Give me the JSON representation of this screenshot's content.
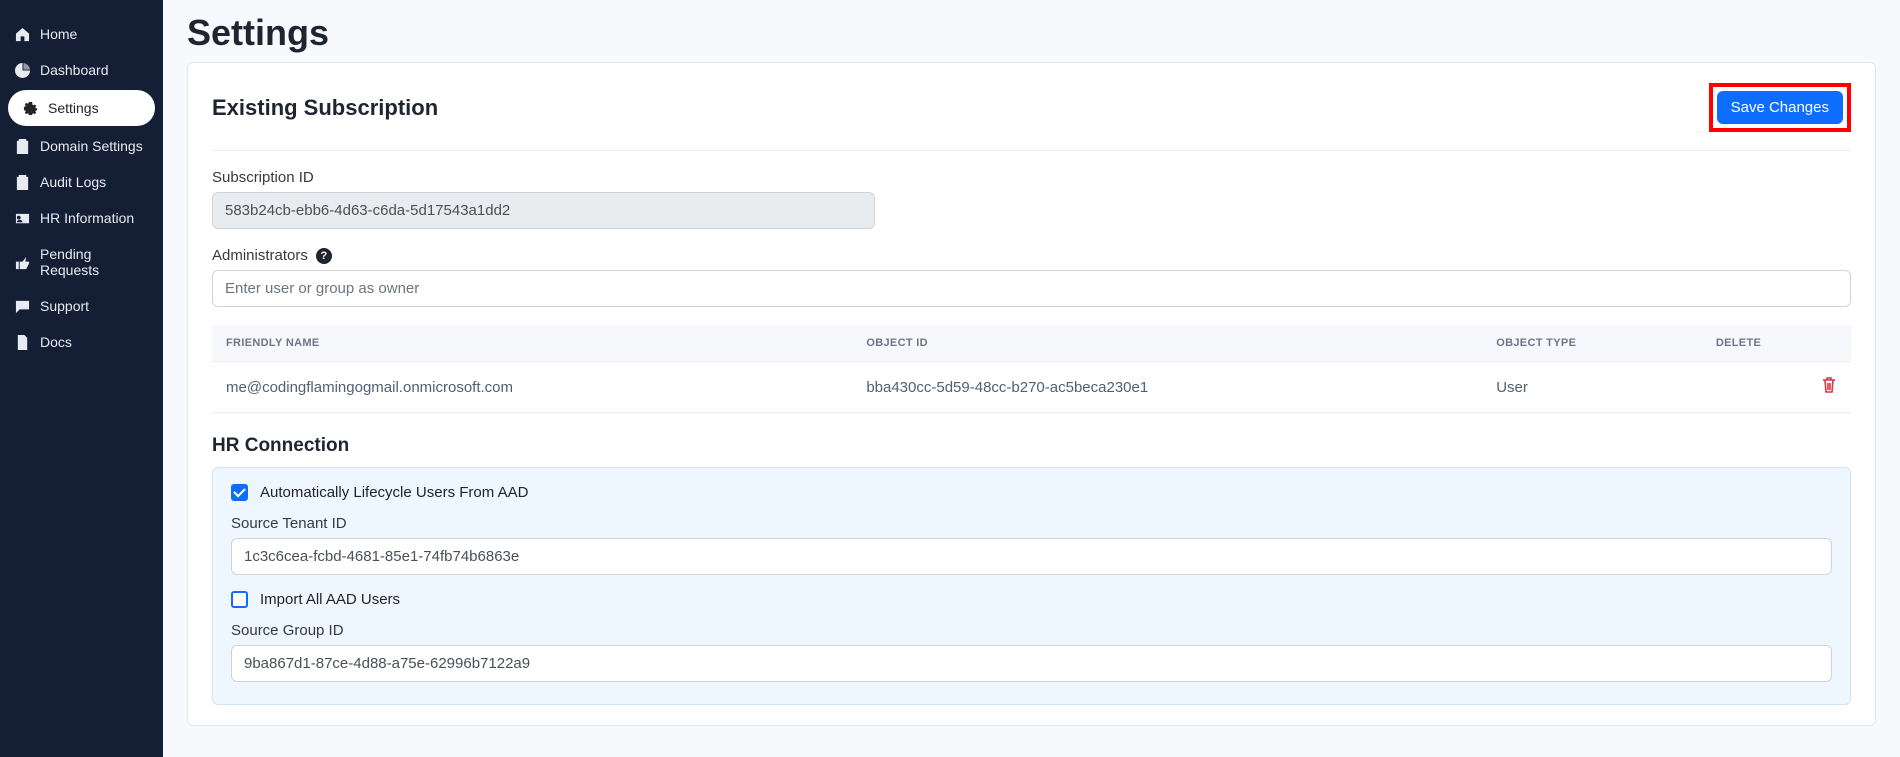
{
  "page": {
    "title": "Settings"
  },
  "sidebar": {
    "items": [
      {
        "label": "Home",
        "icon": "home"
      },
      {
        "label": "Dashboard",
        "icon": "pie"
      },
      {
        "label": "Settings",
        "icon": "gear"
      },
      {
        "label": "Domain Settings",
        "icon": "clipboard"
      },
      {
        "label": "Audit Logs",
        "icon": "clipboard"
      },
      {
        "label": "HR Information",
        "icon": "id-card"
      },
      {
        "label": "Pending Requests",
        "icon": "thumb"
      },
      {
        "label": "Support",
        "icon": "chat"
      },
      {
        "label": "Docs",
        "icon": "file"
      }
    ],
    "active_index": 2
  },
  "subscription": {
    "section_title": "Existing Subscription",
    "save_label": "Save Changes",
    "id_label": "Subscription ID",
    "id_value": "583b24cb-ebb6-4d63-c6da-5d17543a1dd2",
    "admins_label": "Administrators",
    "admins_placeholder": "Enter user or group as owner"
  },
  "admins_table": {
    "headers": {
      "name": "FRIENDLY NAME",
      "object_id": "OBJECT ID",
      "object_type": "OBJECT TYPE",
      "delete": "DELETE"
    },
    "rows": [
      {
        "name": "me@codingflamingogmail.onmicrosoft.com",
        "object_id": "bba430cc-5d59-48cc-b270-ac5beca230e1",
        "object_type": "User"
      }
    ]
  },
  "hr": {
    "section_title": "HR Connection",
    "auto_lifecycle_label": "Automatically Lifecycle Users From AAD",
    "auto_lifecycle_checked": true,
    "source_tenant_label": "Source Tenant ID",
    "source_tenant_value": "1c3c6cea-fcbd-4681-85e1-74fb74b6863e",
    "import_all_label": "Import All AAD Users",
    "import_all_checked": false,
    "source_group_label": "Source Group ID",
    "source_group_value": "9ba867d1-87ce-4d88-a75e-62996b7122a9"
  }
}
